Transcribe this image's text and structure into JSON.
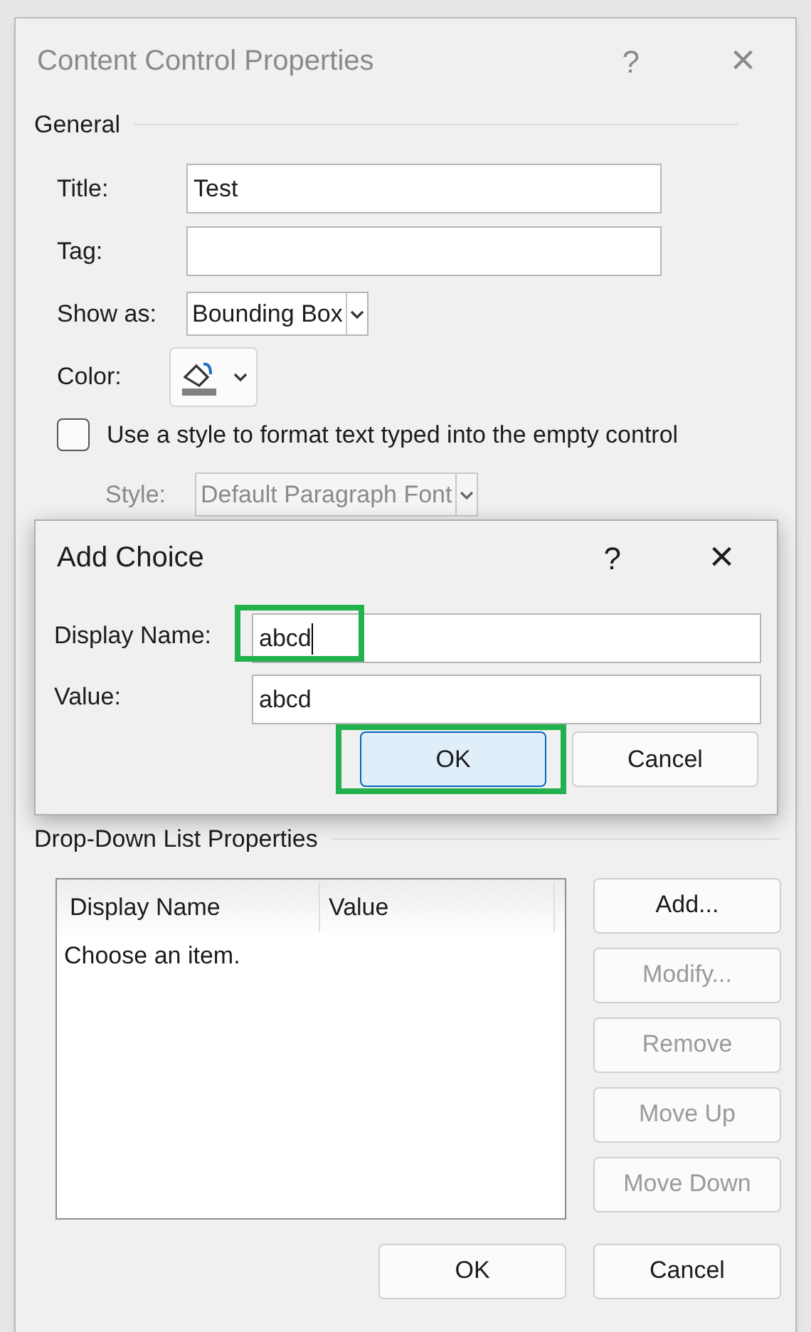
{
  "window": {
    "title": "Content Control Properties",
    "help": "?",
    "close": "×",
    "active": false
  },
  "general": {
    "heading": "General",
    "fields": [
      {
        "kind": "text",
        "label": "Title:",
        "value": "Test"
      },
      {
        "kind": "text",
        "label": "Tag:"
      },
      {
        "kind": "select",
        "label": "Show as:",
        "value": "Bounding Box",
        "disabled": false
      },
      {
        "kind": "color",
        "label": "Color:"
      }
    ],
    "style_checkbox": {
      "label": "Use a style to format text typed into the empty control",
      "checked": false
    },
    "style_select": {
      "label": "Style:",
      "value": "Default Paragraph Font",
      "disabled": true
    }
  },
  "dropdown_list": {
    "heading": "Drop-Down List Properties",
    "columns": [
      "Display Name",
      "Value"
    ],
    "rows": [
      {
        "display_name": "Choose an item."
      }
    ],
    "buttons": [
      {
        "label": "Add...",
        "disabled": false
      },
      {
        "label": "Modify...",
        "disabled": true
      },
      {
        "label": "Remove",
        "disabled": true
      },
      {
        "label": "Move Up",
        "disabled": true
      },
      {
        "label": "Move Down",
        "disabled": true
      }
    ]
  },
  "buttons": [
    {
      "label": "OK"
    },
    {
      "label": "Cancel"
    }
  ],
  "add_choice": {
    "title": "Add Choice",
    "help": "?",
    "close": "×",
    "fields": [
      {
        "label": "Display Name:",
        "value": "abcd",
        "highlighted": true,
        "focused": true
      },
      {
        "label": "Value:",
        "value": "abcd",
        "highlighted": false,
        "focused": false
      }
    ],
    "buttons": [
      {
        "label": "OK",
        "default": true,
        "highlighted": true
      },
      {
        "label": "Cancel",
        "default": false,
        "highlighted": false
      }
    ]
  }
}
